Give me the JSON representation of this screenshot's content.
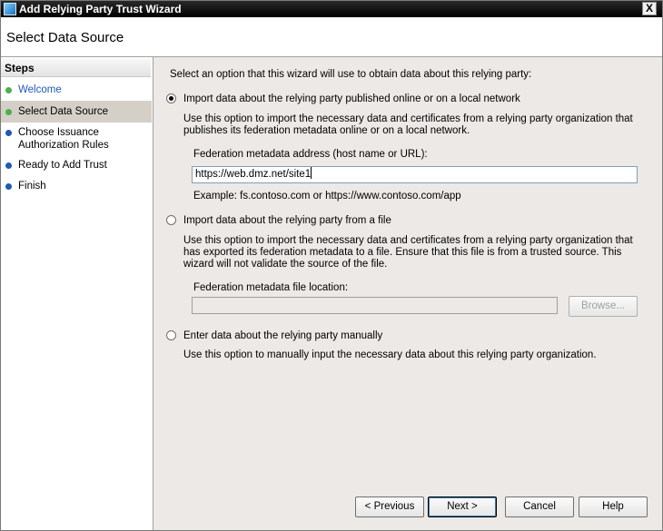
{
  "window": {
    "title": "Add Relying Party Trust Wizard",
    "close_label": "X",
    "page_title": "Select Data Source"
  },
  "sidebar": {
    "title": "Steps",
    "items": [
      {
        "label": "Welcome",
        "status_color": "#4caf50",
        "link": true
      },
      {
        "label": "Select Data Source",
        "status_color": "#4caf50",
        "active": true
      },
      {
        "label": "Choose Issuance Authorization Rules",
        "status_color": "#1e5ab4"
      },
      {
        "label": "Ready to Add Trust",
        "status_color": "#1e5ab4"
      },
      {
        "label": "Finish",
        "status_color": "#1e5ab4"
      }
    ]
  },
  "main": {
    "intro": "Select an option that this wizard will use to obtain data about this relying party:",
    "option_online": {
      "label": "Import data about the relying party published online or on a local network",
      "description": "Use this option to import the necessary data and certificates from a relying party organization that publishes its federation metadata online or on a local network.",
      "field_label": "Federation metadata address (host name or URL):",
      "field_value": "https://web.dmz.net/site1",
      "example": "Example: fs.contoso.com or https://www.contoso.com/app",
      "selected": true
    },
    "option_file": {
      "label": "Import data about the relying party from a file",
      "description": "Use this option to import the necessary data and certificates from a relying party organization that has exported its federation metadata to a file. Ensure that this file is from a trusted source.  This wizard will not validate the source of the file.",
      "field_label": "Federation metadata file location:",
      "field_value": "",
      "browse_label": "Browse...",
      "selected": false
    },
    "option_manual": {
      "label": "Enter data about the relying party manually",
      "description": "Use this option to manually input the necessary data about this relying party organization.",
      "selected": false
    }
  },
  "footer": {
    "previous_label": "< Previous",
    "next_label": "Next >",
    "cancel_label": "Cancel",
    "help_label": "Help"
  },
  "colors": {
    "link": "#1e5ab4",
    "titlebar": "#000000",
    "panel": "#ece9e6"
  }
}
